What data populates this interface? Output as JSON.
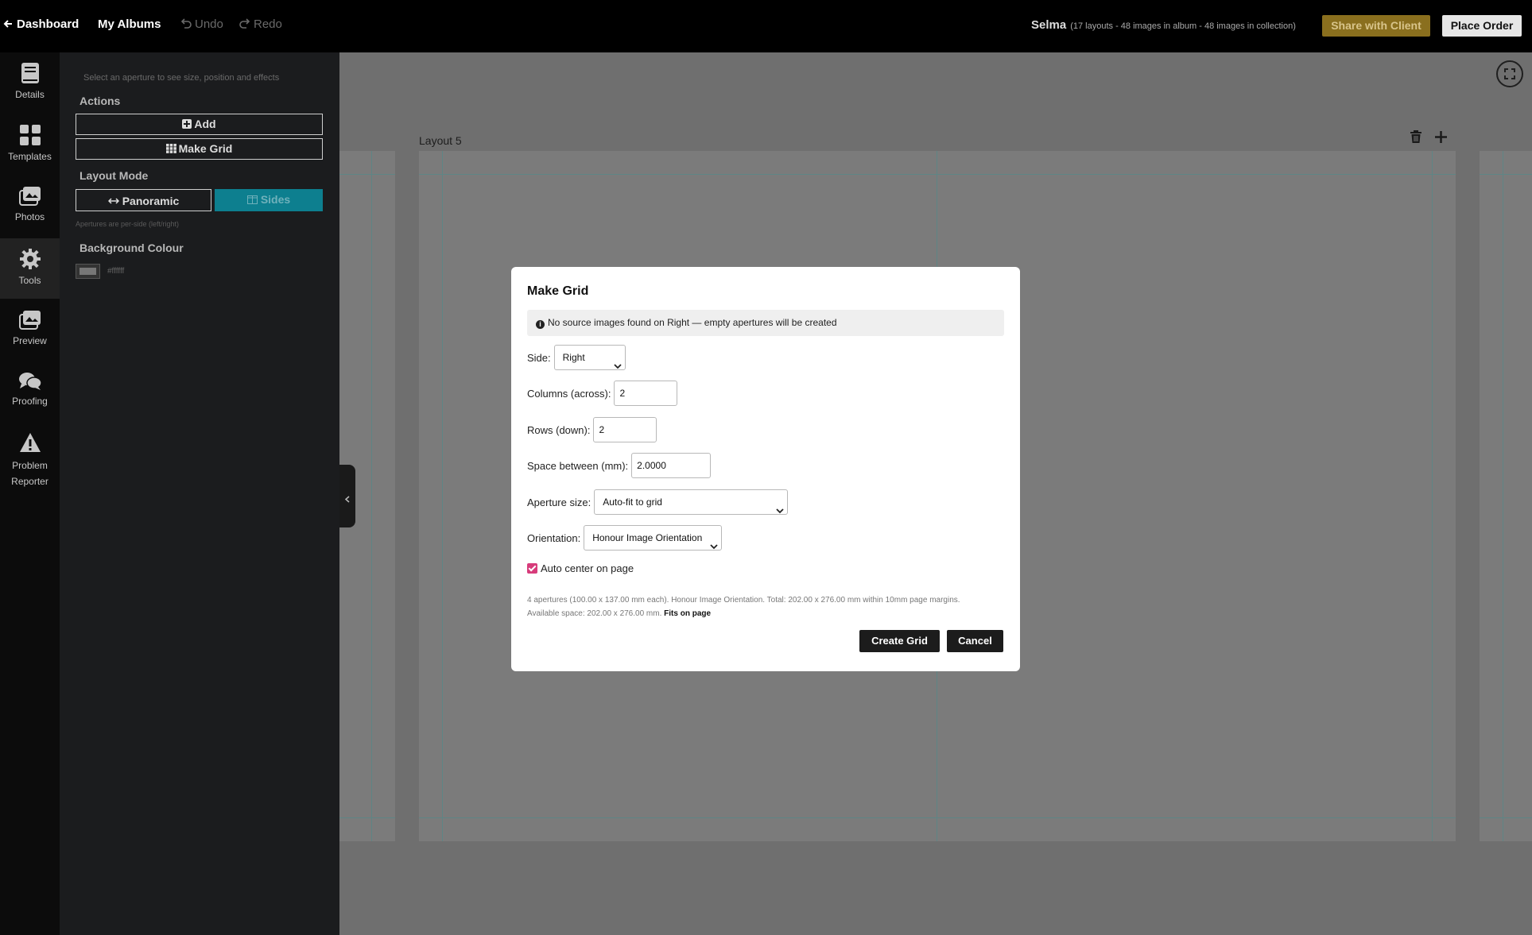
{
  "topbar": {
    "dashboard": "Dashboard",
    "my_albums": "My Albums",
    "undo": "Undo",
    "redo": "Redo",
    "album_name": "Selma",
    "album_stats": "(17 layouts - 48 images in album - 48 images in collection)",
    "share": "Share with Client",
    "place_order": "Place Order"
  },
  "iconbar": {
    "items": [
      {
        "label": "Details",
        "icon": "book-icon"
      },
      {
        "label": "Templates",
        "icon": "grid-icon"
      },
      {
        "label": "Photos",
        "icon": "photos-icon"
      },
      {
        "label": "Tools",
        "icon": "gear-icon"
      },
      {
        "label": "Preview",
        "icon": "preview-icon"
      },
      {
        "label": "Proofing",
        "icon": "comments-icon"
      },
      {
        "label": "Problem",
        "label2": "Reporter",
        "icon": "warning-icon"
      }
    ]
  },
  "panel": {
    "hint": "Select an aperture to see size, position and effects",
    "actions_heading": "Actions",
    "add_label": "Add",
    "make_grid_label": "Make Grid",
    "layout_mode_heading": "Layout Mode",
    "panoramic_label": "Panoramic",
    "sides_label": "Sides",
    "sides_hint": "Apertures are per-side (left/right)",
    "bg_heading": "Background Colour",
    "bg_value": "#ffffff"
  },
  "canvas": {
    "layout_label": "Layout 5"
  },
  "modal": {
    "title": "Make Grid",
    "alert": "No source images found on Right — empty apertures will be created",
    "side_label": "Side:",
    "side_value": "Right",
    "columns_label": "Columns (across):",
    "columns_value": "2",
    "rows_label": "Rows (down):",
    "rows_value": "2",
    "space_label": "Space between (mm):",
    "space_value": "2.0000",
    "aperture_label": "Aperture size:",
    "aperture_value": "Auto-fit to grid",
    "orientation_label": "Orientation:",
    "orientation_value": "Honour Image Orientation",
    "auto_center_label": "Auto center on page",
    "summary_line1": "4 apertures (100.00 x 137.00 mm each). Honour Image Orientation. Total: 202.00 x 276.00 mm within 10mm page margins.",
    "summary_line2": "Available space: 202.00 x 276.00 mm.",
    "summary_fits": "Fits on page",
    "create_label": "Create Grid",
    "cancel_label": "Cancel"
  },
  "colors": {
    "accent_share": "#8a6f1e",
    "sides_active": "#0d7f8f",
    "checkbox": "#d73c7b",
    "guide": "#5e8585"
  }
}
